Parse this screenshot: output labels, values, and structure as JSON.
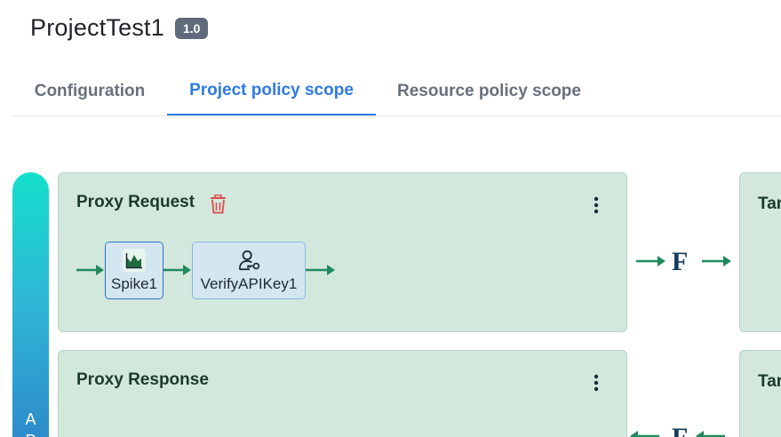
{
  "header": {
    "title": "ProjectTest1",
    "version": "1.0"
  },
  "tabs": [
    {
      "label": "Configuration",
      "active": false
    },
    {
      "label": "Project policy scope",
      "active": true
    },
    {
      "label": "Resource policy scope",
      "active": false
    }
  ],
  "rail": {
    "label": "A\nP"
  },
  "flows": {
    "request": {
      "title": "Proxy Request",
      "policies": [
        {
          "label": "Spike1",
          "icon": "spike-chart-icon"
        },
        {
          "label": "VerifyAPIKey1",
          "icon": "user-key-icon"
        }
      ]
    },
    "response": {
      "title": "Proxy Response"
    },
    "target_request": {
      "title": "Target"
    },
    "target_response": {
      "title": "Target"
    },
    "flow_mark": "F"
  },
  "colors": {
    "accent": "#2f7ae5",
    "card_bg": "#d2e8dd",
    "arrow": "#1f8a5a",
    "delete": "#e04a4a"
  }
}
